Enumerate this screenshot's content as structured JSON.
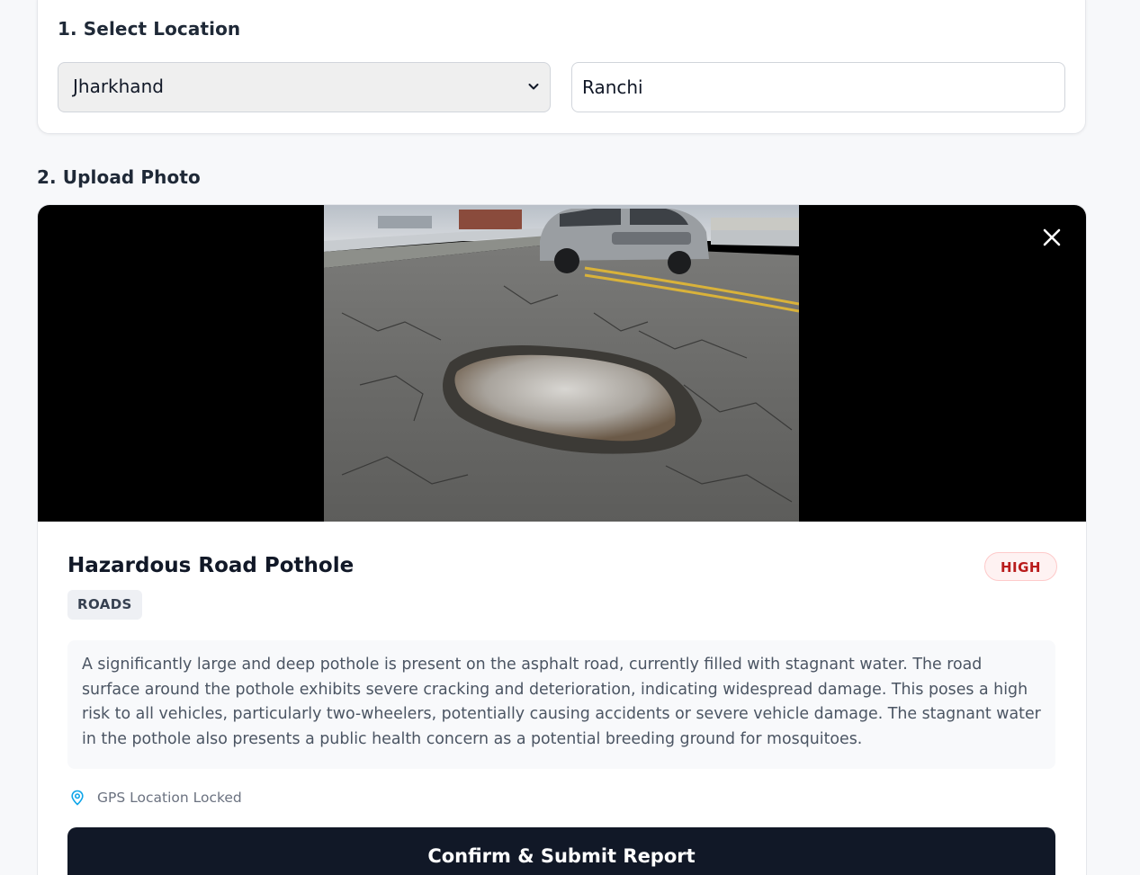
{
  "location": {
    "title": "1. Select Location",
    "state_selected": "Jharkhand",
    "city_value": "Ranchi"
  },
  "upload": {
    "title": "2. Upload Photo",
    "close_icon": "close-icon"
  },
  "report": {
    "title": "Hazardous Road Pothole",
    "severity": "HIGH",
    "category": "ROADS",
    "description": "A significantly large and deep pothole is present on the asphalt road, currently filled with stagnant water. The road surface around the pothole exhibits severe cracking and deterioration, indicating widespread damage. This poses a high risk to all vehicles, particularly two-wheelers, potentially causing accidents or severe vehicle damage. The stagnant water in the pothole also presents a public health concern as a potential breeding ground for mosquitoes.",
    "gps_status": "GPS Location Locked",
    "gps_icon": "map-pin-icon",
    "submit_label": "Confirm & Submit Report"
  },
  "colors": {
    "primary_button": "#111827",
    "severity_text": "#b91c1c",
    "severity_bg": "#fef2f2",
    "gps_icon": "#0ea5e9"
  }
}
